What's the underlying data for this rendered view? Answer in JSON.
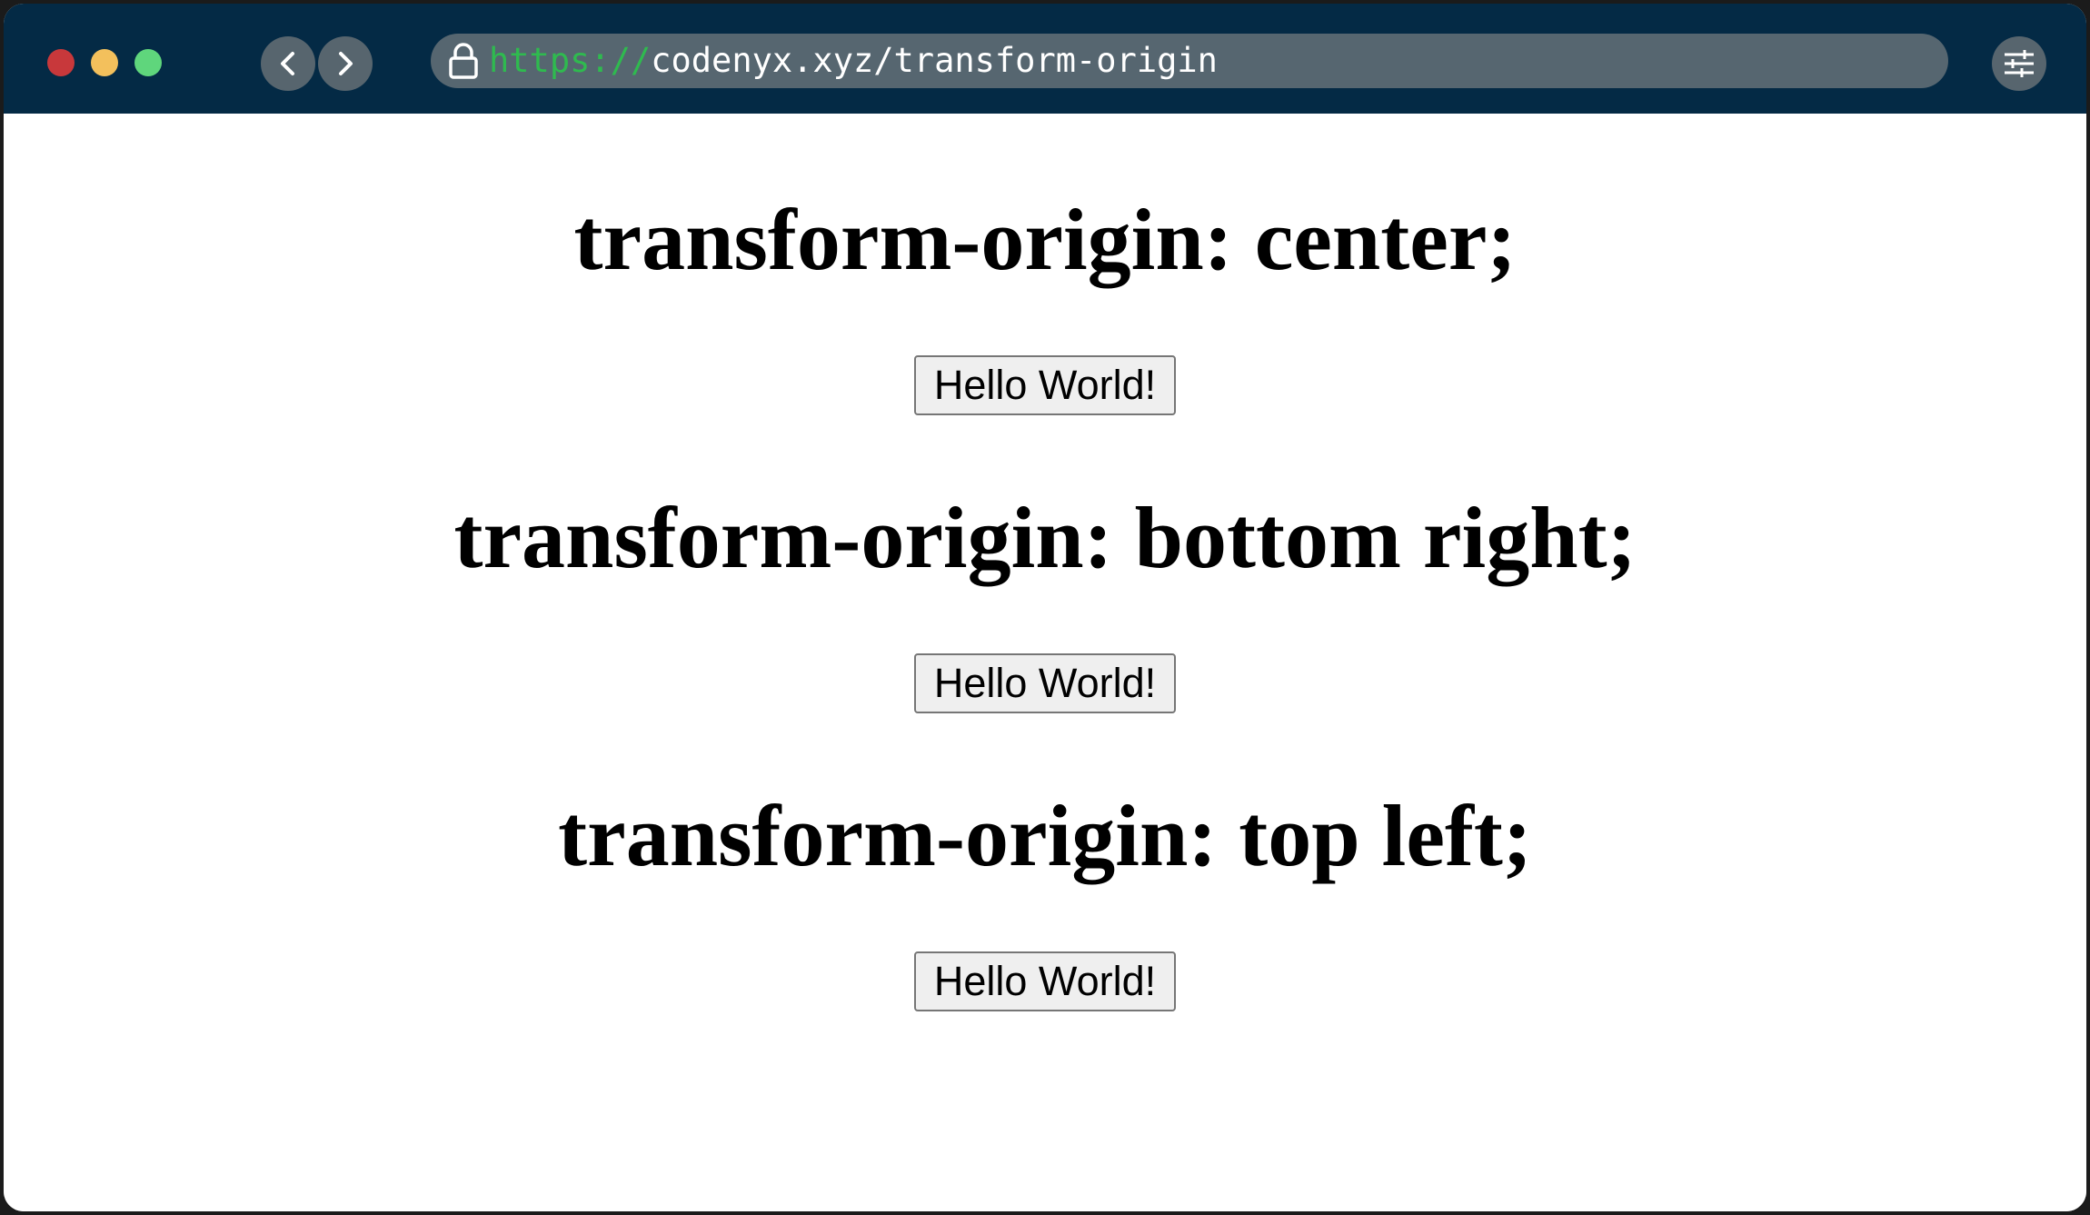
{
  "browser": {
    "url_scheme": "https://",
    "url_rest": "codenyx.xyz/transform-origin",
    "icons": {
      "close": "red-dot",
      "minimize": "yellow-dot",
      "maximize": "green-dot",
      "back": "chevron-left-icon",
      "forward": "chevron-right-icon",
      "lock": "lock-icon",
      "menu": "sliders-icon"
    }
  },
  "sections": [
    {
      "heading": "transform-origin: center;",
      "button": "Hello World!"
    },
    {
      "heading": "transform-origin: bottom right;",
      "button": "Hello World!"
    },
    {
      "heading": "transform-origin: top left;",
      "button": "Hello World!"
    }
  ],
  "colors": {
    "titlebar": "#042a45",
    "url_scheme": "#2fba4f",
    "urlbar": "#566670"
  }
}
